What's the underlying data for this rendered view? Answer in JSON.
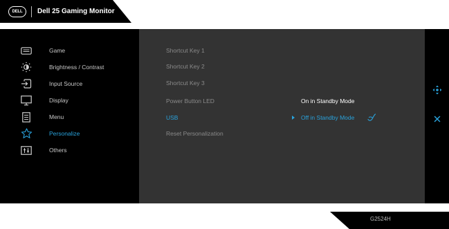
{
  "header": {
    "logo_text": "DELL",
    "title": "Dell 25 Gaming Monitor"
  },
  "colors": {
    "accent": "#29a2dc",
    "panel": "#333333",
    "background": "#000000"
  },
  "menu": {
    "items": [
      {
        "label": "Game",
        "icon": "game-icon"
      },
      {
        "label": "Brightness / Contrast",
        "icon": "brightness-icon"
      },
      {
        "label": "Input Source",
        "icon": "input-source-icon"
      },
      {
        "label": "Display",
        "icon": "display-icon"
      },
      {
        "label": "Menu",
        "icon": "menu-icon"
      },
      {
        "label": "Personalize",
        "icon": "star-icon",
        "active": true
      },
      {
        "label": "Others",
        "icon": "others-icon"
      }
    ]
  },
  "personalize": {
    "items": [
      {
        "label": "Shortcut Key 1"
      },
      {
        "label": "Shortcut Key 2"
      },
      {
        "label": "Shortcut Key 3"
      },
      {
        "label": "Power Button LED"
      },
      {
        "label": "USB",
        "active": true
      },
      {
        "label": "Reset Personalization"
      }
    ],
    "options": {
      "on_standby": "On in Standby Mode",
      "off_standby": "Off in Standby Mode"
    }
  },
  "navigation": {
    "icons": [
      "joystick-icon",
      "close-icon"
    ]
  },
  "model": "G2524H"
}
